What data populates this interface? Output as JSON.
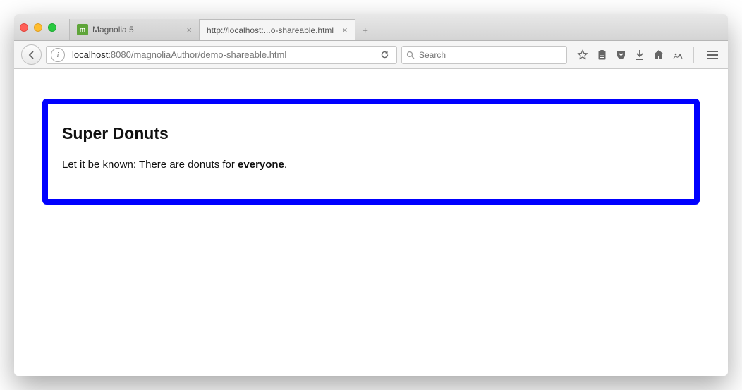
{
  "tabs": [
    {
      "label": "Magnolia 5",
      "favicon": "m"
    },
    {
      "label": "http://localhost:...o-shareable.html"
    }
  ],
  "url": {
    "host": "localhost",
    "port": ":8080",
    "path": "/magnoliaAuthor/demo-shareable.html"
  },
  "search": {
    "placeholder": "Search"
  },
  "page": {
    "title": "Super Donuts",
    "body_prefix": "Let it be known: There are donuts for ",
    "body_bold": "everyone",
    "body_suffix": "."
  },
  "colors": {
    "frame_border": "#0000ff"
  }
}
